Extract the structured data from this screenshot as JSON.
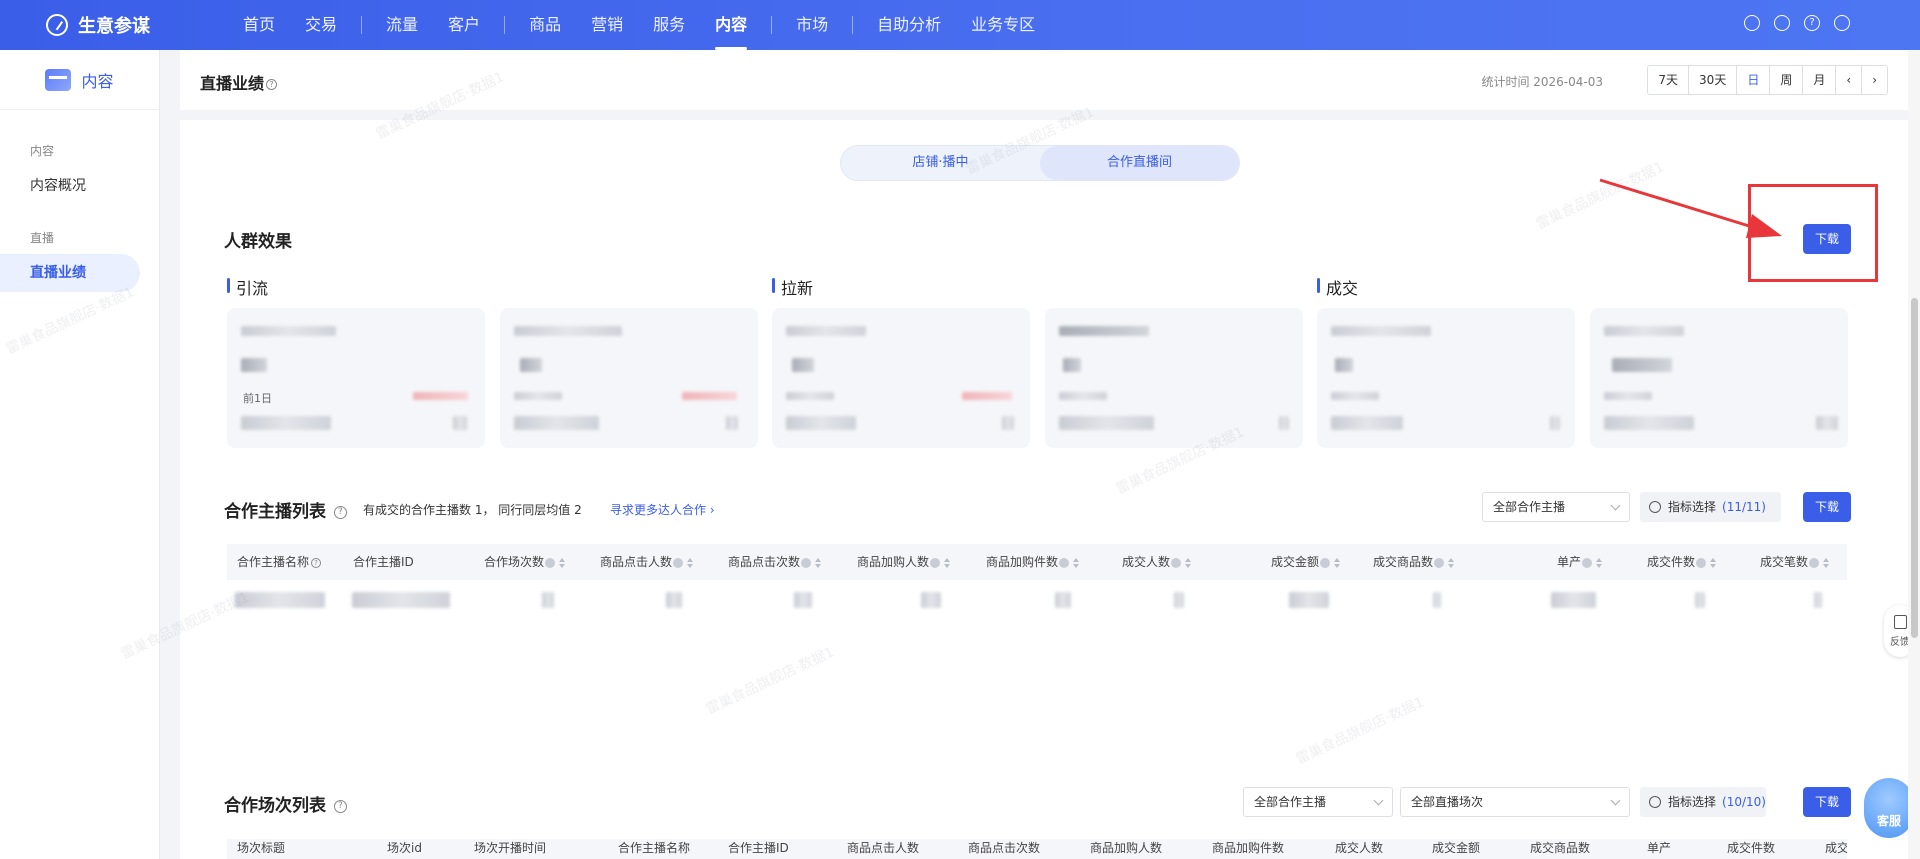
{
  "app": {
    "name": "生意参谋"
  },
  "nav": {
    "items": [
      "首页",
      "交易",
      "流量",
      "客户",
      "商品",
      "营销",
      "服务",
      "内容",
      "市场",
      "自助分析",
      "业务专区"
    ],
    "active": "内容"
  },
  "top_icons": [
    "bag-icon",
    "user-icon",
    "help-icon",
    "logout-icon"
  ],
  "sidebar": {
    "header": "内容",
    "groups": [
      {
        "label": "内容",
        "items": [
          "内容概况"
        ]
      },
      {
        "label": "直播",
        "items": [
          "直播业绩"
        ]
      }
    ]
  },
  "header": {
    "title": "直播业绩",
    "help": "?",
    "stat_time": "统计时间 2026-04-03",
    "ranges": [
      "7天",
      "30天",
      "日",
      "周",
      "月"
    ],
    "active_range": "日",
    "prev": "‹",
    "next": "›"
  },
  "segment": {
    "options": [
      "店铺·播中",
      "合作直播间"
    ],
    "selected": "合作直播间"
  },
  "crowd": {
    "title": "人群效果",
    "download": "下载",
    "groups": [
      "引流",
      "拉新",
      "成交"
    ],
    "card_snippet": "前1日"
  },
  "anchors": {
    "title": "合作主播列表",
    "hint": "有成交的合作主播数 1， 同行同层均值 2",
    "link": "寻求更多达人合作 ›",
    "select": "全部合作主播",
    "metric_label": "指标选择",
    "metric_count": "(11/11)",
    "download": "下载",
    "columns": [
      "合作主播名称",
      "合作主播ID",
      "合作场次数",
      "商品点击人数",
      "商品点击次数",
      "商品加购人数",
      "商品加购件数",
      "成交人数",
      "成交金额",
      "成交商品数",
      "单产",
      "成交件数",
      "成交笔数"
    ]
  },
  "sessions": {
    "title": "合作场次列表",
    "select1": "全部合作主播",
    "select2": "全部直播场次",
    "metric_label": "指标选择",
    "metric_count": "(10/10)",
    "download": "下载",
    "columns": [
      "场次标题",
      "场次id",
      "场次开播时间",
      "合作主播名称",
      "合作主播ID",
      "商品点击人数",
      "商品点击次数",
      "商品加购人数",
      "商品加购件数",
      "成交人数",
      "成交金额",
      "成交商品数",
      "单产",
      "成交件数",
      "成交"
    ]
  },
  "float": {
    "feedback": "反馈",
    "service": "客服"
  },
  "colors": {
    "primary": "#3a5ee8",
    "annotation": "#e8363a"
  }
}
